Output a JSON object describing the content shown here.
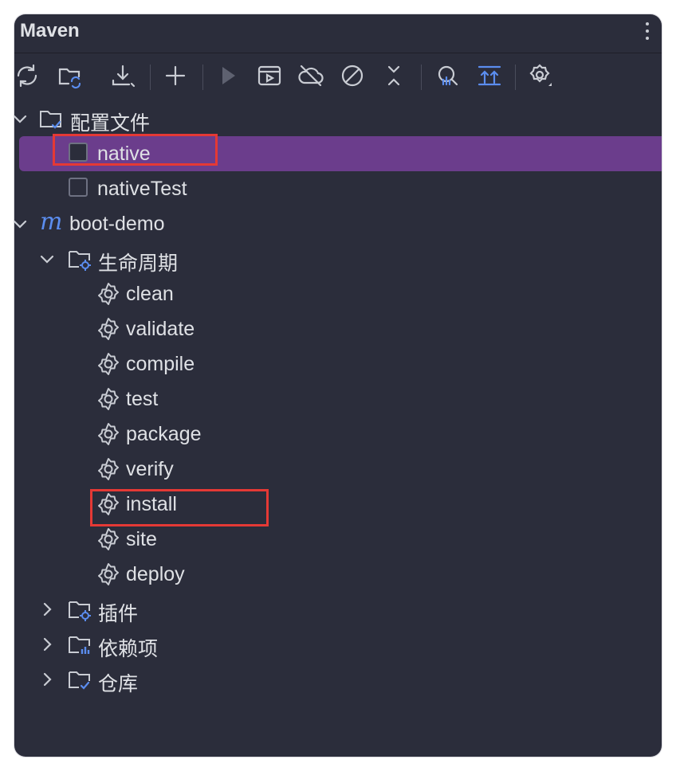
{
  "panel": {
    "title": "Maven"
  },
  "toolbar": {
    "icons": [
      "reload-all-icon",
      "reimport-icon",
      "download-icon",
      "add-icon",
      "run-icon",
      "execute-goal-icon",
      "toggle-offline-icon",
      "skip-tests-icon",
      "collapse-all-icon",
      "analyze-dependencies-icon",
      "show-dependencies-icon",
      "settings-icon"
    ]
  },
  "profiles": {
    "label": "配置文件",
    "items": [
      {
        "label": "native",
        "selected": true
      },
      {
        "label": "nativeTest",
        "selected": false
      }
    ]
  },
  "project": {
    "label": "boot-demo",
    "logo": "m",
    "lifecycle": {
      "label": "生命周期",
      "goals": [
        "clean",
        "validate",
        "compile",
        "test",
        "package",
        "verify",
        "install",
        "site",
        "deploy"
      ]
    },
    "plugins_label": "插件",
    "dependencies_label": "依赖项",
    "repositories_label": "仓库"
  },
  "colors": {
    "background": "#2b2d3b",
    "selection": "#6b3d8c",
    "highlight_box": "#e53935",
    "accent": "#5b8def"
  }
}
